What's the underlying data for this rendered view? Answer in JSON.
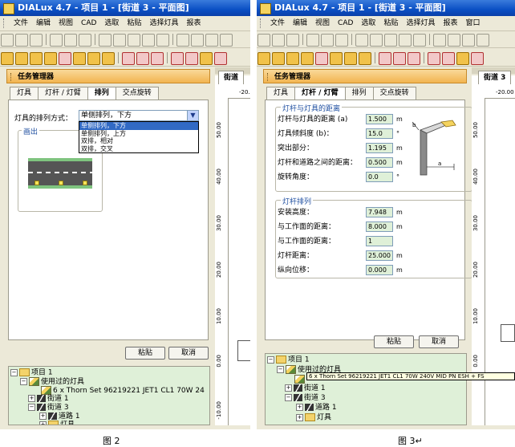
{
  "figure1": {
    "window_title": "DIALux 4.7 - 项目 1 - [街道 3 - 平面图]",
    "menu": [
      "文件",
      "编辑",
      "视图",
      "CAD",
      "选取",
      "粘贴",
      "选择灯具",
      "报表"
    ],
    "task_manager_title": "任务管理器",
    "tabs": [
      "灯具",
      "灯杆 / 灯臂",
      "排列",
      "交点旋转"
    ],
    "view_tab": "街道",
    "ruler_top": "-20.",
    "ruler_left": [
      "50.00",
      "40.00",
      "30.00",
      "20.00",
      "10.00",
      "0.00",
      "-10.00"
    ],
    "arrangement_label": "灯具的排列方式：",
    "arrangement_selected": "单侧排列，下方",
    "arrangement_options": [
      "单侧排列，下方",
      "单侧排列，上方",
      "双排，相对",
      "双排，交叉"
    ],
    "preview_group": "画出",
    "buttons": {
      "paste": "粘贴",
      "cancel": "取消"
    },
    "tree": {
      "project": "项目 1",
      "used_luminaires": "使用过的灯具",
      "luminaire": "6 x Thorn Set 96219221 JET1 CL1 70W 24",
      "street1": "街道 1",
      "street3": "街道 3",
      "road1": "道路 1",
      "luminaires": "灯具"
    },
    "caption": "图 2"
  },
  "figure2": {
    "window_title": "DIALux 4.7 - 项目 1 - [街道 3 - 平面图]",
    "menu": [
      "文件",
      "编辑",
      "视图",
      "CAD",
      "选取",
      "粘贴",
      "选择灯具",
      "报表",
      "窗口"
    ],
    "task_manager_title": "任务管理器",
    "tabs": [
      "灯具",
      "灯杆 / 灯臂",
      "排列",
      "交点旋转"
    ],
    "view_tab": "街道 3",
    "ruler_top": "-20.00",
    "ruler_left": [
      "50.00",
      "40.00",
      "30.00",
      "20.00",
      "10.00",
      "0.00"
    ],
    "group1_title": "灯杆与灯具的距离",
    "group1_fields": [
      {
        "label": "灯杆与灯具的距离 (a)",
        "value": "1.500",
        "unit": "m"
      },
      {
        "label": "灯具倾斜度 (b)：",
        "value": "15.0",
        "unit": "°"
      },
      {
        "label": "突出部分：",
        "value": "1.195",
        "unit": "m"
      },
      {
        "label": "灯杆和道路之间的距离：",
        "value": "0.500",
        "unit": "m"
      },
      {
        "label": "旋转角度：",
        "value": "0.0",
        "unit": "°"
      }
    ],
    "diagram_labels": {
      "b": "b",
      "a": "a"
    },
    "group2_title": "灯杆排列",
    "group2_fields": [
      {
        "label": "安装高度：",
        "value": "7.948",
        "unit": "m"
      },
      {
        "label": "与工作面的距离：",
        "value": "8.000",
        "unit": "m"
      },
      {
        "label": "与工作面的距离：",
        "value": "1",
        "unit": ""
      },
      {
        "label": "灯杆距离：",
        "value": "25.000",
        "unit": "m"
      },
      {
        "label": "纵向位移：",
        "value": "0.000",
        "unit": "m"
      }
    ],
    "buttons": {
      "paste": "粘贴",
      "cancel": "取消"
    },
    "tree": {
      "project": "项目 1",
      "used_luminaires": "使用过的灯具",
      "luminaire_tooltip": "6 x Thorn Set 96219221 JET1 CL1 70W 240V MID PN ESH + FS",
      "street1": "街道 1",
      "street3": "街道 3",
      "road1": "道路 1",
      "luminaires": "灯具"
    },
    "caption": "图 3↵"
  }
}
